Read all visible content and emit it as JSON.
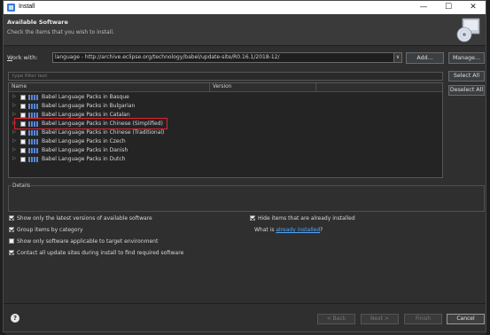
{
  "window": {
    "title": "Install"
  },
  "banner": {
    "heading": "Available Software",
    "subtitle": "Check the items that you wish to install."
  },
  "work_with": {
    "label_prefix": "W",
    "label_rest": "ork with:",
    "value": "language - http://archive.eclipse.org/technology/babel/update-site/R0.16.1/2018-12/",
    "combo_arrow": "∨",
    "add_label": "Add...",
    "manage_label": "Manage..."
  },
  "filter": {
    "placeholder": "type filter text"
  },
  "buttons": {
    "select_all": "Select All",
    "deselect_all": "Deselect All",
    "back": "< Back",
    "next": "Next >",
    "finish": "Finish",
    "cancel": "Cancel"
  },
  "tree": {
    "columns": [
      "Name",
      "Version"
    ],
    "items": [
      {
        "label": "Babel Language Packs in Basque",
        "checked": false
      },
      {
        "label": "Babel Language Packs in Bulgarian",
        "checked": false
      },
      {
        "label": "Babel Language Packs in Catalan",
        "checked": false
      },
      {
        "label": "Babel Language Packs in Chinese (Simplified)",
        "checked": false,
        "highlighted": true
      },
      {
        "label": "Babel Language Packs in Chinese (Traditional)",
        "checked": false
      },
      {
        "label": "Babel Language Packs in Czech",
        "checked": false
      },
      {
        "label": "Babel Language Packs in Danish",
        "checked": false
      },
      {
        "label": "Babel Language Packs in Dutch",
        "checked": false
      }
    ]
  },
  "details": {
    "label": "Details"
  },
  "options": {
    "latest_versions": "Show only the latest versions of available software",
    "group_by_category": "Group items by category",
    "target_env": "Show only software applicable to target environment",
    "contact_sites": "Contact all update sites during install to find required software",
    "hide_installed": "Hide items that are already installed",
    "whatis_prefix": "What is ",
    "whatis_link": "already installed",
    "whatis_suffix": "?"
  },
  "colors": {
    "accent_link": "#4ea8ff",
    "highlight_border": "#e0242e",
    "package_icon": "#5b86d6"
  }
}
